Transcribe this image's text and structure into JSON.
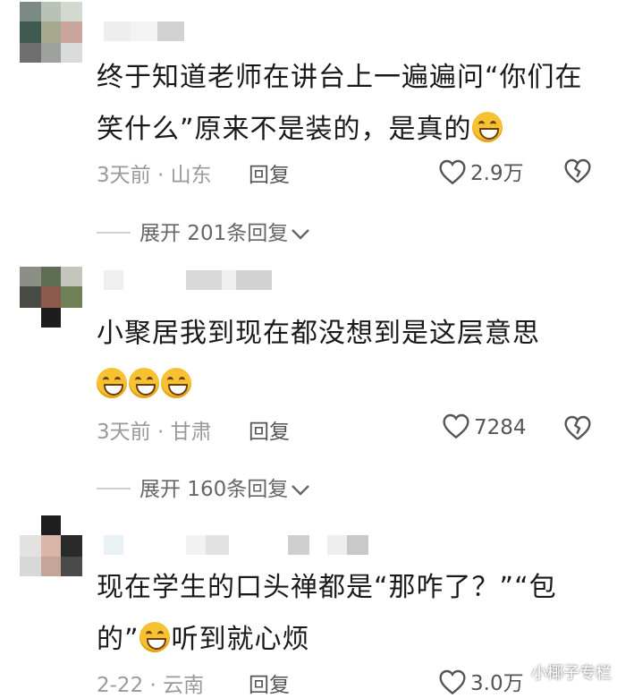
{
  "comments": [
    {
      "text": "终于知道老师在讲台上一遍遍问“你们在笑什么”原来不是装的，是真的",
      "time_location": "3天前 · 山东",
      "reply_label": "回复",
      "likes": "2.9万",
      "expand_label": "展开 201条回复"
    },
    {
      "text": "小聚居我到现在都没想到是这层意思",
      "time_location": "3天前 · 甘肃",
      "reply_label": "回复",
      "likes": "7284",
      "expand_label": "展开 160条回复"
    },
    {
      "text_part1": "现在学生的口头禅都是“那咋了？”“包的”",
      "text_part2": "听到就心烦",
      "time_location": "2-22 · 云南",
      "reply_label": "回复",
      "likes": "3.0万"
    }
  ],
  "watermark": "小椰子专栏",
  "icons": [
    "heart-outline-icon",
    "broken-heart-icon",
    "chevron-down-icon",
    "grinning-emoji-icon",
    "winking-tongue-emoji-icon"
  ]
}
